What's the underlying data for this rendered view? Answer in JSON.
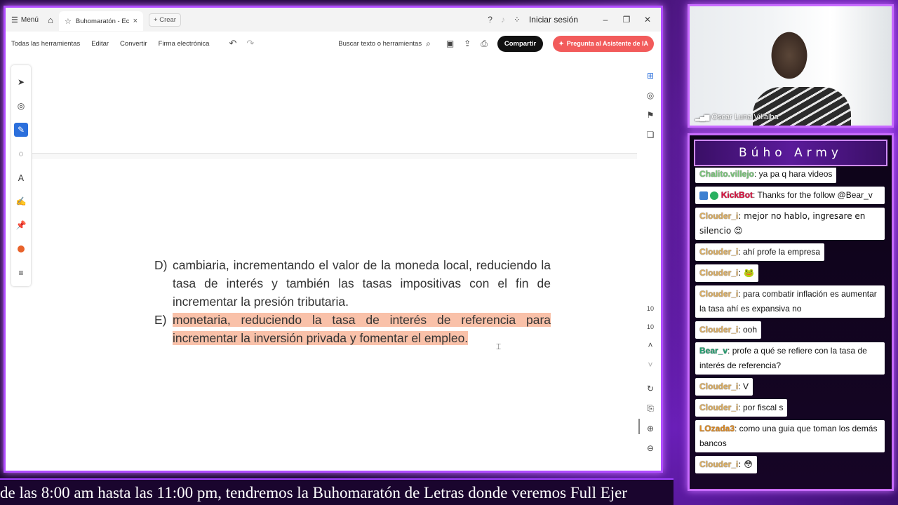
{
  "app": {
    "menu_label": "Menú",
    "tab_title": "Buhomaratón - Econo...",
    "new_tab_label": "Crear",
    "login_label": "Iniciar sesión"
  },
  "toolbar": {
    "all_tools": "Todas las herramientas",
    "edit": "Editar",
    "convert": "Convertir",
    "esign": "Firma electrónica",
    "search_placeholder": "Buscar texto o herramientas",
    "share_label": "Compartir",
    "ai_label": "Pregunta al Asistente de IA"
  },
  "document": {
    "option_d_letter": "D)",
    "option_d_text": "cambiaria, incrementando el valor de la moneda local, reduciendo la tasa de interés y también las tasas impositivas con el fin de incrementar la presión tributaria.",
    "option_e_letter": "E)",
    "option_e_text": "monetaria, reduciendo la tasa de interés de referencia para incrementar la inversión privada y fomentar el empleo."
  },
  "right_rail": {
    "page_current": "10",
    "page_total": "10"
  },
  "webcam": {
    "name": "Oscar Luna Villalba"
  },
  "chat": {
    "title": "Búho Army",
    "messages": [
      {
        "user": "Chalito.villejo",
        "text": ": ya pa q hara videos",
        "color": "#7ac87a"
      },
      {
        "user": "KickBot",
        "text": ": Thanks for the follow @Bear_v",
        "color": "#e01040"
      },
      {
        "user": "Clouder_i",
        "text": ": mejor no hablo, ingresare en silencio 😍",
        "color": "#e0b060"
      },
      {
        "user": "Clouder_i",
        "text": ": ahí profe la empresa",
        "color": "#e0b060"
      },
      {
        "user": "Clouder_i",
        "text": ": 🐸",
        "color": "#e0b060"
      },
      {
        "user": "Clouder_i",
        "text": ": para combatir inflación es aumentar la tasa ahí es expansiva no",
        "color": "#e0b060"
      },
      {
        "user": "Clouder_i",
        "text": ": ooh",
        "color": "#e0b060"
      },
      {
        "user": "Bear_v",
        "text": ": profe a qué se refiere con la tasa de interés de referencia?",
        "color": "#20a070"
      },
      {
        "user": "Clouder_i",
        "text": ": V",
        "color": "#e0b060"
      },
      {
        "user": "Clouder_i",
        "text": ": por fiscal s",
        "color": "#e0b060"
      },
      {
        "user": "LOzada3",
        "text": ": como una guia que toman los demás bancos",
        "color": "#e08a20"
      },
      {
        "user": "Clouder_i",
        "text": ": 😳",
        "color": "#e0b060"
      }
    ]
  },
  "ticker": {
    "text": "de las 8:00 am hasta las 11:00 pm, tendremos la Buhomaratón de Letras donde veremos Full Ejer"
  },
  "icons": {
    "home": "home-icon",
    "star": "star-icon",
    "help": "help-icon",
    "bell": "bell-icon",
    "apps": "apps-icon"
  },
  "colors": {
    "frame_accent": "#c86bff",
    "highlight": "#f9c1a9",
    "share_bg": "#111111",
    "ai_bg": "#f25b5b",
    "tool_active": "#2b6fdc"
  }
}
